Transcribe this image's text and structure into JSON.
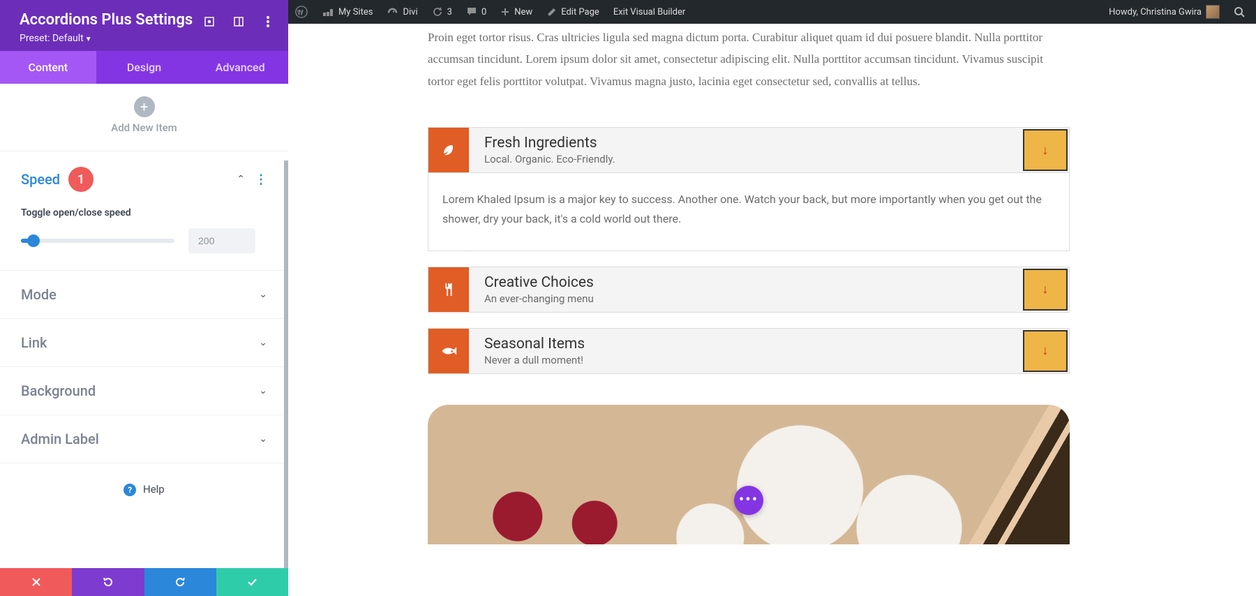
{
  "sidebar": {
    "title": "Accordions Plus Settings",
    "preset": "Preset: Default",
    "tabs": [
      "Content",
      "Design",
      "Advanced"
    ],
    "addNew": "Add New Item",
    "speed": {
      "title": "Speed",
      "badge": "1",
      "toggleLabel": "Toggle open/close speed",
      "value": "200"
    },
    "sections": [
      "Mode",
      "Link",
      "Background",
      "Admin Label"
    ],
    "help": "Help"
  },
  "adminBar": {
    "mySites": "My Sites",
    "divi": "Divi",
    "updates": "3",
    "comments": "0",
    "new": "New",
    "editPage": "Edit Page",
    "exit": "Exit Visual Builder",
    "howdy": "Howdy, Christina Gwira"
  },
  "content": {
    "intro": "Proin eget tortor risus. Cras ultricies ligula sed magna dictum porta. Curabitur aliquet quam id dui posuere blandit. Nulla porttitor accumsan tincidunt. Lorem ipsum dolor sit amet, consectetur adipiscing elit. Nulla porttitor accumsan tincidunt. Vivamus suscipit tortor eget felis porttitor volutpat. Vivamus magna justo, lacinia eget consectetur sed, convallis at tellus.",
    "accordion": [
      {
        "title": "Fresh Ingredients",
        "sub": "Local. Organic. Eco-Friendly.",
        "icon": "leaf",
        "body": "Lorem Khaled Ipsum is a major key to success. Another one. Watch your back, but more importantly when you get out the shower, dry your back, it's a cold world out there."
      },
      {
        "title": "Creative Choices",
        "sub": "An ever-changing menu",
        "icon": "utensils"
      },
      {
        "title": "Seasonal Items",
        "sub": "Never a dull moment!",
        "icon": "fish"
      }
    ]
  }
}
